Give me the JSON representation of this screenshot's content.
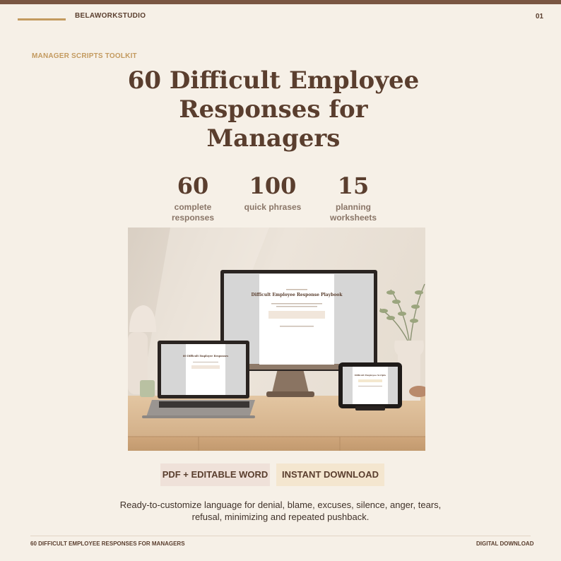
{
  "header": {
    "brand": "BELAWORKSTUDIO",
    "page_number": "01"
  },
  "kicker": "MANAGER SCRIPTS TOOLKIT",
  "title_lines": [
    "60 Difficult Employee",
    "Responses for",
    "Managers"
  ],
  "stats": [
    {
      "number": "60",
      "label_lines": [
        "complete",
        "responses"
      ]
    },
    {
      "number": "100",
      "label_lines": [
        "quick phrases"
      ]
    },
    {
      "number": "15",
      "label_lines": [
        "planning",
        "worksheets"
      ]
    }
  ],
  "mockup": {
    "monitor_doc_title": "Difficult Employee Response Playbook",
    "laptop_doc_title": "60 Difficult Employee Responses",
    "tablet_doc_title": "Difficult Employee Scripts"
  },
  "badges": {
    "format": "PDF + EDITABLE WORD",
    "delivery": "INSTANT DOWNLOAD"
  },
  "description": "Ready-to-customize language for denial, blame, excuses, silence, anger, tears, refusal, minimizing and repeated pushback.",
  "footer": {
    "left": "60 DIFFICULT EMPLOYEE RESPONSES FOR MANAGERS",
    "right": "DIGITAL DOWNLOAD"
  },
  "colors": {
    "brown": "#5a3e2e",
    "accent": "#c39a5f",
    "background": "#f6f0e7",
    "top_bar": "#7a5642"
  }
}
